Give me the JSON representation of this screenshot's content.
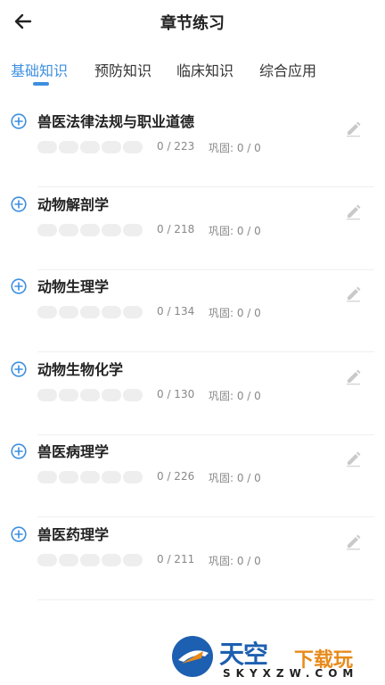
{
  "header": {
    "title": "章节练习",
    "back_icon": "arrow-left-icon"
  },
  "tabs": [
    {
      "label": "基础知识",
      "active": true
    },
    {
      "label": "预防知识",
      "active": false
    },
    {
      "label": "临床知识",
      "active": false
    },
    {
      "label": "综合应用",
      "active": false
    }
  ],
  "colors": {
    "accent": "#3d8fe0",
    "text": "#222222",
    "muted": "#888888",
    "pill": "#eeeeee"
  },
  "chapters": [
    {
      "name": "兽医法律法规与职业道德",
      "count": "0 / 223",
      "consolidate": "巩固: 0 / 0"
    },
    {
      "name": "动物解剖学",
      "count": "0 / 218",
      "consolidate": "巩固: 0 / 0"
    },
    {
      "name": "动物生理学",
      "count": "0 / 134",
      "consolidate": "巩固: 0 / 0"
    },
    {
      "name": "动物生物化学",
      "count": "0 / 130",
      "consolidate": "巩固: 0 / 0"
    },
    {
      "name": "兽医病理学",
      "count": "0 / 226",
      "consolidate": "巩固: 0 / 0"
    },
    {
      "name": "兽医药理学",
      "count": "0 / 211",
      "consolidate": "巩固: 0 / 0"
    }
  ],
  "watermark": {
    "main": "天空",
    "accent": "下载玩",
    "domain": "SKYXZW.COM"
  }
}
